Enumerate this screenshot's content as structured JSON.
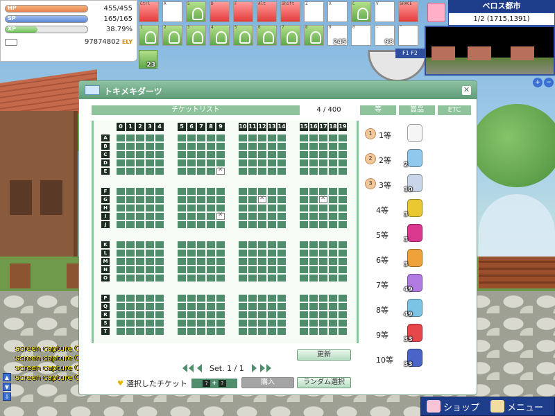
{
  "status": {
    "hp_label": "HP",
    "hp_value": "455/455",
    "hp_fill": 1.0,
    "sp_label": "SP",
    "sp_value": "165/165",
    "sp_fill": 1.0,
    "xp_label": "XP",
    "xp_value": "38.79%",
    "xp_fill": 0.3879,
    "zeny": "97874802",
    "zeny_unit": "ELY"
  },
  "hotkeys": {
    "row1": [
      {
        "key": "Ctrl",
        "kind": "red"
      },
      {
        "key": "A",
        "kind": "empty"
      },
      {
        "key": "S",
        "kind": "skill"
      },
      {
        "key": "D",
        "kind": "red"
      },
      {
        "key": "F",
        "kind": "red"
      },
      {
        "key": "Alt",
        "kind": "red"
      },
      {
        "key": "Shift",
        "kind": "red"
      },
      {
        "key": "Z",
        "kind": "item"
      },
      {
        "key": "X",
        "kind": "empty"
      },
      {
        "key": "C",
        "kind": "skill"
      },
      {
        "key": "V",
        "kind": "empty"
      },
      {
        "key": "SPACE",
        "kind": "red"
      }
    ],
    "row2": [
      {
        "key": "1",
        "kind": "skill"
      },
      {
        "key": "2",
        "kind": "skill"
      },
      {
        "key": "3",
        "kind": "skill"
      },
      {
        "key": "4",
        "kind": "skill"
      },
      {
        "key": "5",
        "kind": "skill"
      },
      {
        "key": "6",
        "kind": "skill"
      },
      {
        "key": "7",
        "kind": "skill"
      },
      {
        "key": "8",
        "kind": "skill"
      },
      {
        "key": "9",
        "kind": "item",
        "count": "245"
      },
      {
        "key": "0",
        "kind": "item"
      },
      {
        "key": "-",
        "kind": "item",
        "count": "98"
      },
      {
        "key": "^",
        "kind": "empty"
      }
    ],
    "extra_count": "23"
  },
  "minimap": {
    "map_name": "ベロス都市",
    "coords": "1/2 (1715,1391)",
    "fkeys": "F1 F2"
  },
  "chat": {
    "lines": [
      "screen capture O",
      "screen capture O",
      "screen capture O",
      "screen capture O"
    ]
  },
  "bottom_menu": {
    "shop": "ショップ",
    "menu": "メニュー"
  },
  "dialog": {
    "title": "トキメキダーツ",
    "ticket_list_label": "チケットリスト",
    "ticket_count": "4 / 400",
    "header_rank": "等",
    "header_prize": "賞品",
    "header_etc": "ETC",
    "columns": [
      "0",
      "1",
      "2",
      "3",
      "4",
      "5",
      "6",
      "7",
      "8",
      "9",
      "10",
      "11",
      "12",
      "13",
      "14",
      "15",
      "16",
      "17",
      "18",
      "19"
    ],
    "rows": [
      "A",
      "B",
      "C",
      "D",
      "E",
      "F",
      "G",
      "H",
      "I",
      "J",
      "K",
      "L",
      "M",
      "N",
      "O",
      "P",
      "Q",
      "R",
      "S",
      "T"
    ],
    "marked_cells": [
      {
        "row": "E",
        "col": 9
      },
      {
        "row": "G",
        "col": 12
      },
      {
        "row": "G",
        "col": 17
      },
      {
        "row": "I",
        "col": 9
      }
    ],
    "refresh_label": "更新",
    "set_label": "Set. 1 / 1",
    "selected_label": "選択したチケット",
    "selected_value": [
      "?",
      "?"
    ],
    "buy_label": "購入",
    "random_label": "ランダム選択",
    "prizes": [
      {
        "rank": "1等",
        "badge": "1",
        "qty": "",
        "color": "#f5f5f5"
      },
      {
        "rank": "2等",
        "badge": "2",
        "qty": "2",
        "color": "#8fc8ec"
      },
      {
        "rank": "3等",
        "badge": "3",
        "qty": "10",
        "color": "#c9d6ea"
      },
      {
        "rank": "4等",
        "badge": "",
        "qty": "3",
        "color": "#e9c832"
      },
      {
        "rank": "5等",
        "badge": "",
        "qty": "3",
        "color": "#d9388e"
      },
      {
        "rank": "6等",
        "badge": "",
        "qty": "3",
        "color": "#f0a23a"
      },
      {
        "rank": "7等",
        "badge": "",
        "qty": "49",
        "color": "#b07ae0"
      },
      {
        "rank": "8等",
        "badge": "",
        "qty": "49",
        "color": "#7cc4e6"
      },
      {
        "rank": "9等",
        "badge": "",
        "qty": "33",
        "color": "#e6474a"
      },
      {
        "rank": "10等",
        "badge": "",
        "qty": "33",
        "color": "#4a64c8"
      }
    ]
  }
}
